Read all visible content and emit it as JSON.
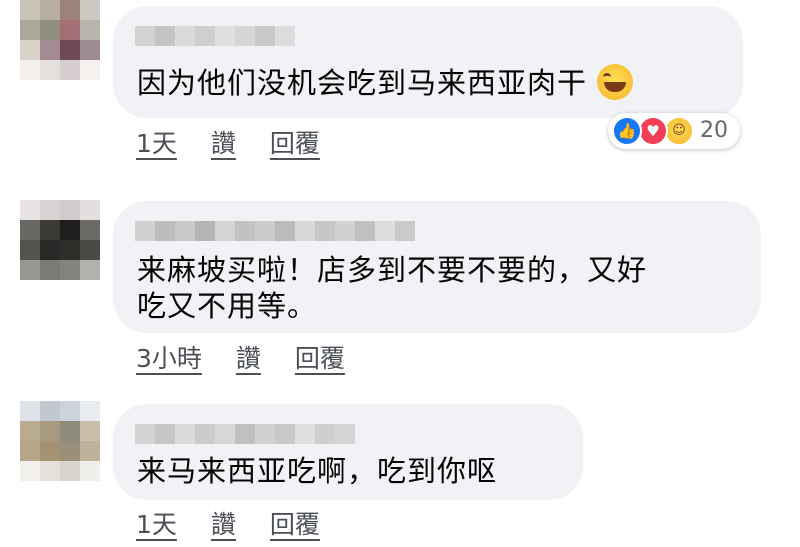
{
  "comments": [
    {
      "text": "因为他们没机会吃到马来西亚肉干",
      "emoji": "laughing-tears-emoji",
      "actions": {
        "time": "1天",
        "like": "讚",
        "reply": "回覆"
      },
      "reactions": {
        "count": "20",
        "icons": [
          "like-icon",
          "love-icon",
          "haha-icon"
        ]
      }
    },
    {
      "text_line1": "来麻坡买啦！店多到不要不要的，又好",
      "text_line2": "吃又不用等。",
      "actions": {
        "time": "3小時",
        "like": "讚",
        "reply": "回覆"
      }
    },
    {
      "text": "来马来西亚吃啊，吃到你呕",
      "actions": {
        "time": "1天",
        "like": "讚",
        "reply": "回覆"
      }
    }
  ],
  "colors": {
    "bubble": "#f0f2f5",
    "text": "#050505",
    "action_text": "#4b4f56",
    "like_blue": "#1877f2",
    "love_red": "#f33e58",
    "haha_yellow": "#f7b125"
  }
}
